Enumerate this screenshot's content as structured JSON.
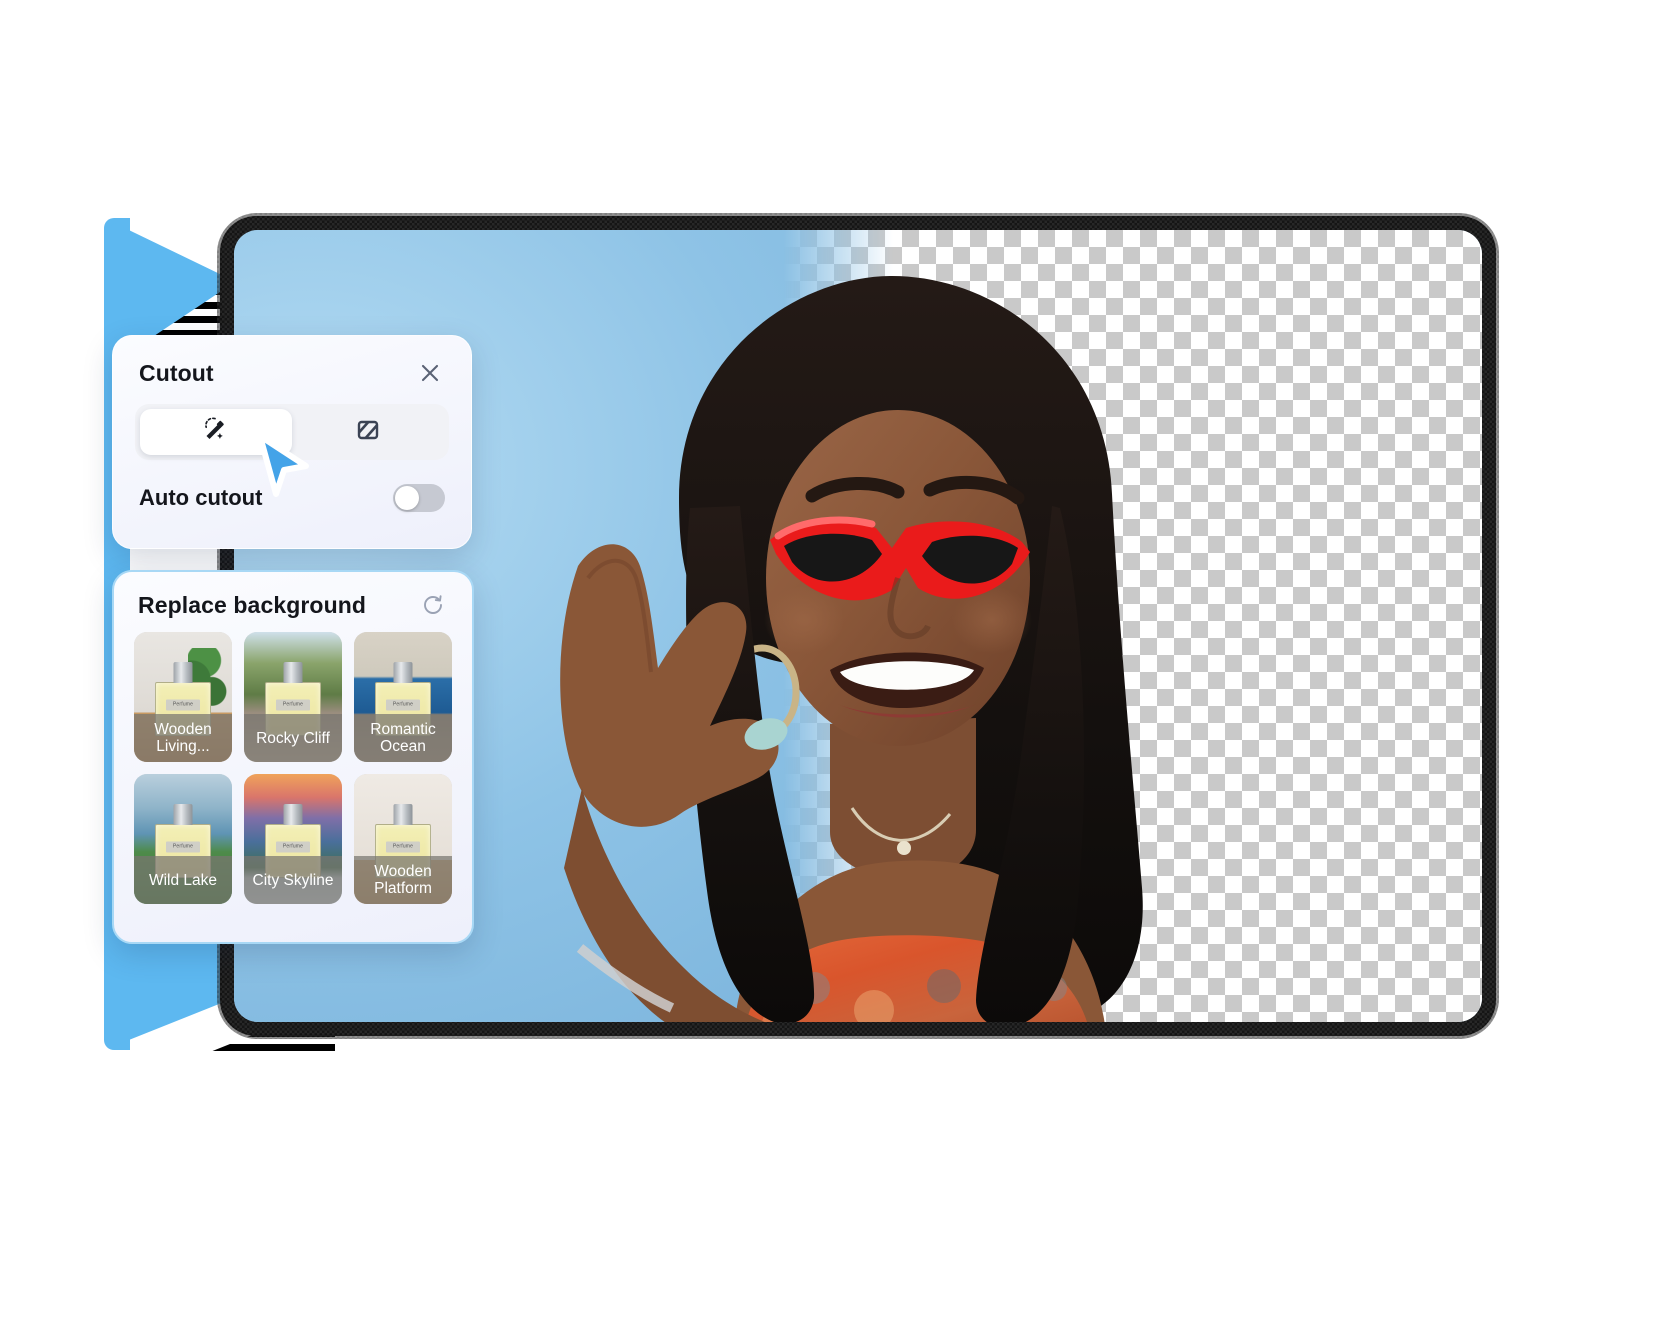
{
  "app": {
    "brand_blue": "#5DB8F0",
    "panel_bg": "#f1f3fb",
    "accent_cursor": "#44A3E8"
  },
  "cutout_panel": {
    "title": "Cutout",
    "close_icon": "close-icon",
    "tools": [
      {
        "id": "magic-wand",
        "icon": "magic-wand-icon",
        "active": true
      },
      {
        "id": "erase-hatch",
        "icon": "hatched-square-icon",
        "active": false
      }
    ],
    "auto_cutout": {
      "label": "Auto cutout",
      "enabled": false
    }
  },
  "replace_panel": {
    "title": "Replace background",
    "reset_icon": "refresh-counterclockwise-icon",
    "thumbnails": [
      {
        "label": "Wooden Living...",
        "scene": "sc-wood",
        "bottle_label": "Perfume"
      },
      {
        "label": "Rocky Cliff",
        "scene": "sc-cliff",
        "bottle_label": "Perfume"
      },
      {
        "label": "Romantic Ocean",
        "scene": "sc-ocean",
        "bottle_label": "Perfume"
      },
      {
        "label": "Wild Lake",
        "scene": "sc-lake",
        "bottle_label": "Perfume"
      },
      {
        "label": "City Skyline",
        "scene": "sc-city",
        "bottle_label": "Perfume"
      },
      {
        "label": "Wooden Platform",
        "scene": "sc-platform",
        "bottle_label": "Perfume"
      }
    ]
  },
  "canvas": {
    "subject_alt": "smiling-woman-with-red-sunglasses",
    "transparency_checker": true
  }
}
